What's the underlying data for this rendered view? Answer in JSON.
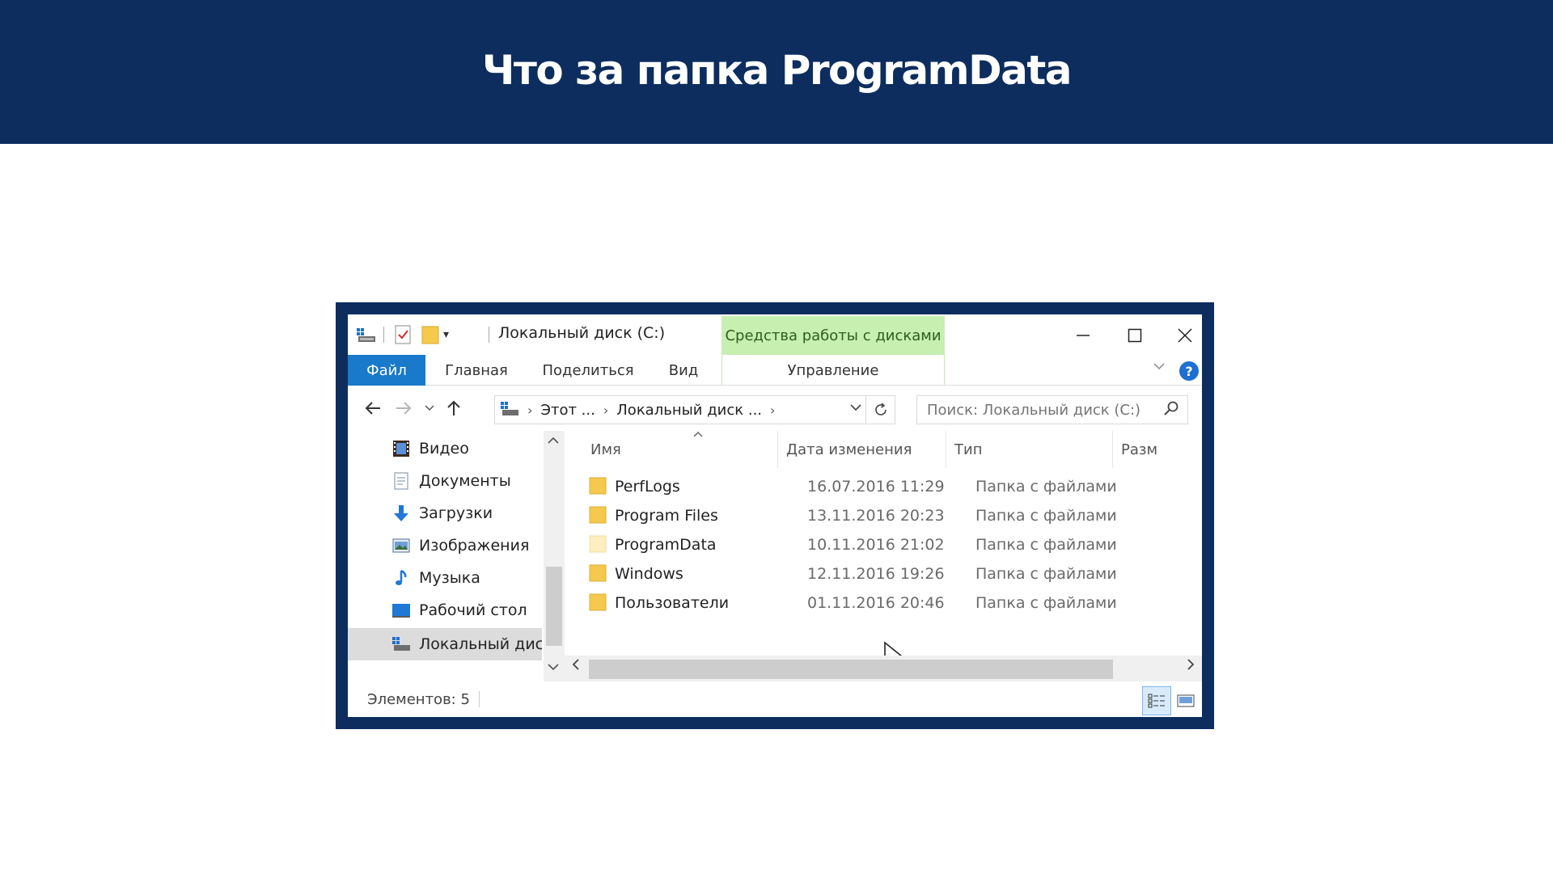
{
  "banner": {
    "title": "Что за папка ProgramData"
  },
  "window": {
    "title": "Локальный диск (C:)",
    "context_tab": "Средства работы с дисками",
    "controls": {
      "minimize": "—",
      "maximize": "☐",
      "close": "✕"
    },
    "ribbon": {
      "tabs": [
        {
          "label": "Файл"
        },
        {
          "label": "Главная"
        },
        {
          "label": "Поделиться"
        },
        {
          "label": "Вид"
        },
        {
          "label": "Управление"
        }
      ],
      "help": "?"
    },
    "nav": {
      "breadcrumb": [
        "Этот ...",
        "Локальный диск ..."
      ],
      "search_placeholder": "Поиск: Локальный диск (C:)"
    },
    "sidebar": {
      "items": [
        {
          "label": "Видео",
          "icon": "video-icon"
        },
        {
          "label": "Документы",
          "icon": "documents-icon"
        },
        {
          "label": "Загрузки",
          "icon": "downloads-icon"
        },
        {
          "label": "Изображения",
          "icon": "pictures-icon"
        },
        {
          "label": "Музыка",
          "icon": "music-icon"
        },
        {
          "label": "Рабочий стол",
          "icon": "desktop-icon"
        },
        {
          "label": "Локальный диск (C:)",
          "icon": "drive-icon",
          "selected": true
        }
      ]
    },
    "columns": [
      {
        "label": "Имя"
      },
      {
        "label": "Дата изменения"
      },
      {
        "label": "Тип"
      },
      {
        "label": "Разм"
      }
    ],
    "files": [
      {
        "name": "PerfLogs",
        "date": "16.07.2016 11:29",
        "type": "Папка с файлами"
      },
      {
        "name": "Program Files",
        "date": "13.11.2016 20:23",
        "type": "Папка с файлами"
      },
      {
        "name": "ProgramData",
        "date": "10.11.2016 21:02",
        "type": "Папка с файлами",
        "hidden": true
      },
      {
        "name": "Windows",
        "date": "12.11.2016 19:26",
        "type": "Папка с файлами"
      },
      {
        "name": "Пользователи",
        "date": "01.11.2016 20:46",
        "type": "Папка с файлами"
      }
    ],
    "status": {
      "count": "Элементов: 5"
    },
    "colors": {
      "banner": "#0c2d5e",
      "file_tab": "#1979ca",
      "context_tab": "#c6efb0",
      "folder": "#f5c94e"
    }
  }
}
